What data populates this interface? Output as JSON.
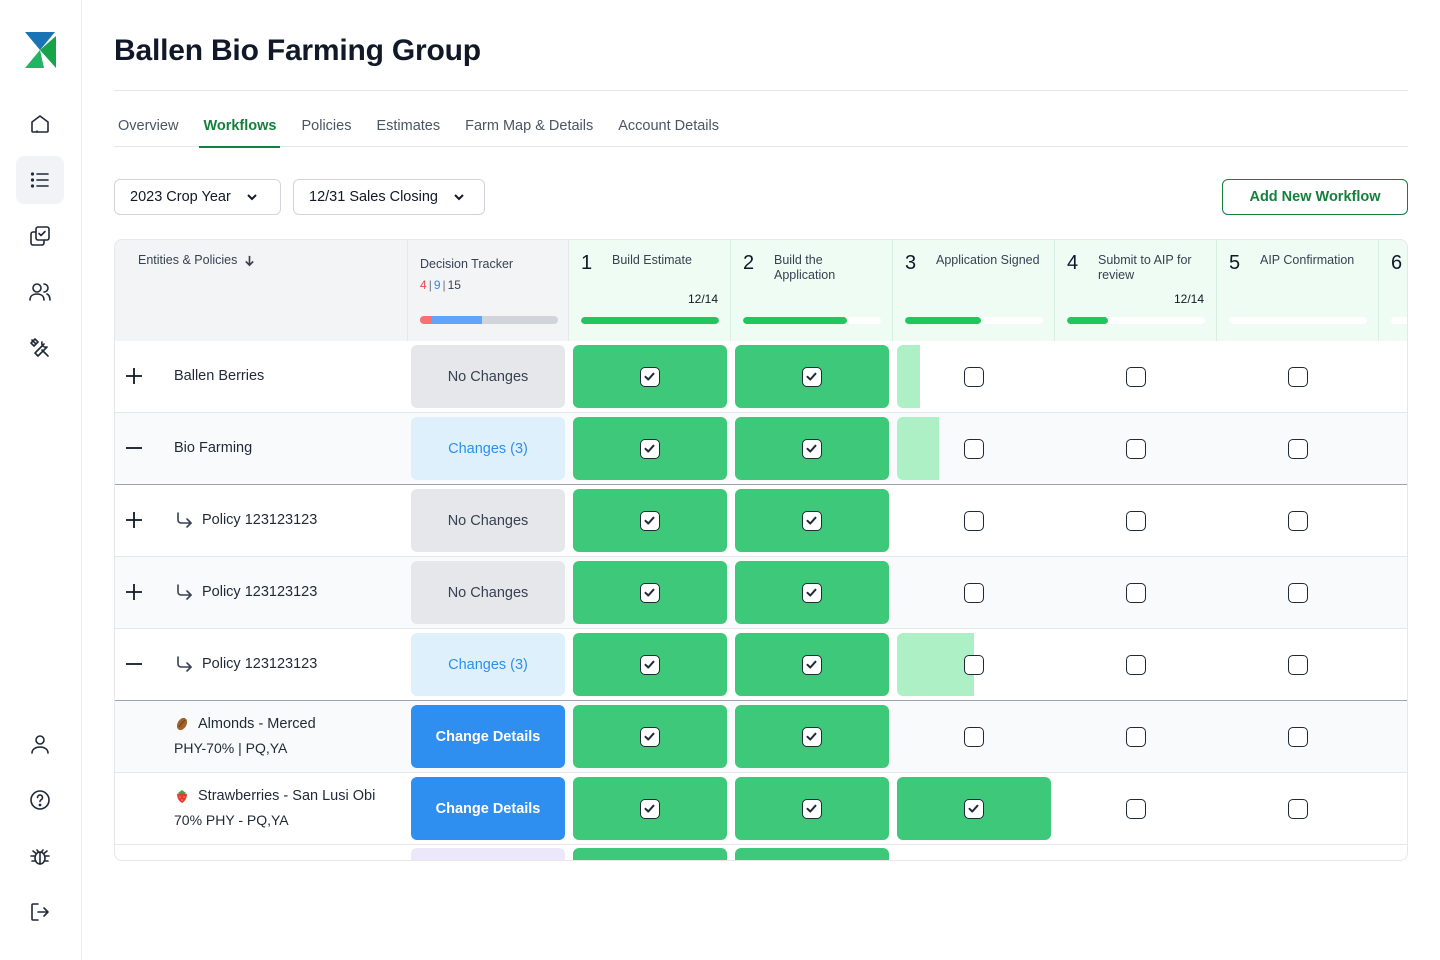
{
  "app": {
    "title": "Ballen Bio Farming Group",
    "accent": "#15803d"
  },
  "sidebar": {
    "items": [
      {
        "icon": "home-icon"
      },
      {
        "icon": "list-icon",
        "active": true
      },
      {
        "icon": "policies-icon"
      },
      {
        "icon": "users-icon"
      },
      {
        "icon": "tools-icon"
      },
      {
        "icon": "user-icon"
      },
      {
        "icon": "help-icon"
      },
      {
        "icon": "bug-icon"
      },
      {
        "icon": "logout-icon"
      }
    ]
  },
  "tabs": [
    {
      "label": "Overview"
    },
    {
      "label": "Workflows",
      "active": true
    },
    {
      "label": "Policies"
    },
    {
      "label": "Estimates"
    },
    {
      "label": "Farm Map & Details"
    },
    {
      "label": "Account Details"
    }
  ],
  "filters": {
    "crop_year": "2023 Crop Year",
    "sales_closing": "12/31 Sales Closing",
    "add_button": "Add New Workflow"
  },
  "table": {
    "entities_header": "Entities & Policies",
    "decision_header": "Decision Tracker",
    "decision_counts": {
      "red": "4",
      "blue": "9",
      "total": "15",
      "sep": "|"
    },
    "decision_bar": {
      "red_fraction": 0.08,
      "blue_fraction": 0.37
    },
    "steps": [
      {
        "num": "1",
        "name": "Build Estimate",
        "frac": "12/14",
        "progress": 1.0
      },
      {
        "num": "2",
        "name": "Build the Application",
        "frac": "",
        "progress": 0.75
      },
      {
        "num": "3",
        "name": "Application Signed",
        "frac": "",
        "progress": 0.55
      },
      {
        "num": "4",
        "name": "Submit to AIP for review",
        "frac": "12/14",
        "progress": 0.3
      },
      {
        "num": "5",
        "name": "AIP Confirmation",
        "frac": "",
        "progress": 0.0
      },
      {
        "num": "6",
        "name": "",
        "frac": "",
        "progress": 0.0
      }
    ],
    "rows": [
      {
        "type": "entity",
        "toggle": "plus",
        "name": "Ballen Berries",
        "decision": "No Changes",
        "decision_kind": "none",
        "steps": [
          "done",
          "done",
          "partial-15",
          "open",
          "open",
          "open"
        ]
      },
      {
        "type": "entity",
        "toggle": "minus",
        "name": "Bio Farming",
        "decision": "Changes (3)",
        "decision_kind": "changes",
        "steps": [
          "done",
          "done",
          "partial-27",
          "open",
          "open",
          "open"
        ]
      },
      {
        "type": "policy",
        "toggle": "plus",
        "name": "Policy 123123123",
        "decision": "No Changes",
        "decision_kind": "none",
        "steps": [
          "done",
          "done",
          "open",
          "open",
          "open",
          "open"
        ]
      },
      {
        "type": "policy",
        "toggle": "plus",
        "name": "Policy 123123123",
        "decision": "No Changes",
        "decision_kind": "none",
        "steps": [
          "done",
          "done",
          "open",
          "open",
          "open",
          "open"
        ]
      },
      {
        "type": "policy",
        "toggle": "minus",
        "name": "Policy 123123123",
        "decision": "Changes (3)",
        "decision_kind": "changes",
        "steps": [
          "done",
          "done",
          "partial-50",
          "open",
          "open",
          "open"
        ]
      },
      {
        "type": "crop",
        "emoji": "almond",
        "name": "Almonds - Merced",
        "sub": "PHY-70% |  PQ,YA",
        "decision": "Change Details",
        "decision_kind": "detail",
        "steps": [
          "done",
          "done",
          "open",
          "open",
          "open",
          "open"
        ]
      },
      {
        "type": "crop",
        "emoji": "strawberry",
        "name": "Strawberries - San Lusi Obi",
        "sub": "70% PHY - PQ,YA",
        "decision": "Change Details",
        "decision_kind": "detail",
        "steps": [
          "done",
          "done",
          "done",
          "open",
          "open",
          "open"
        ]
      }
    ]
  }
}
